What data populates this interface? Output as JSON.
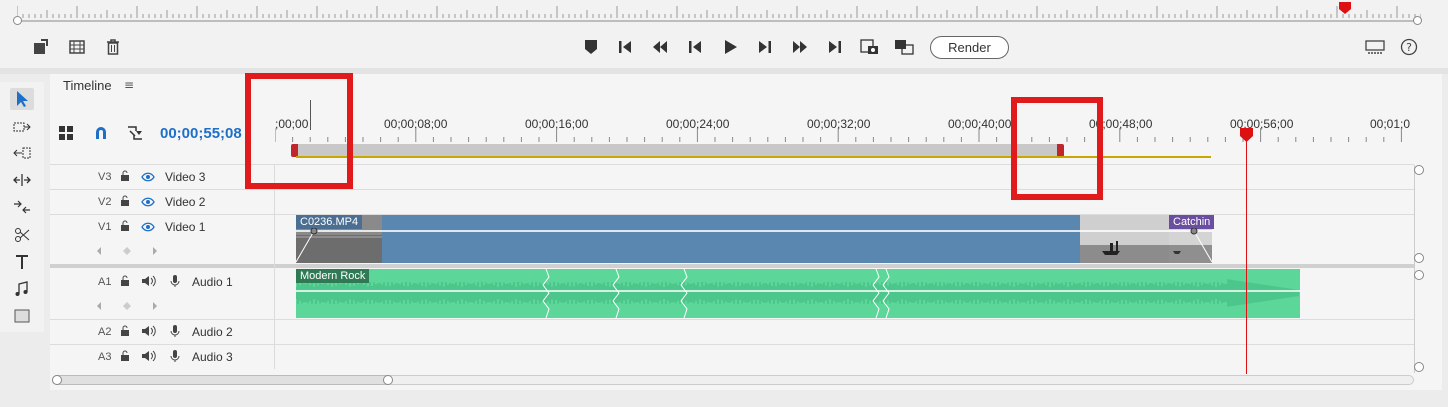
{
  "monitor": {
    "render_label": "Render"
  },
  "timeline": {
    "panel_title": "Timeline",
    "menu_icon": "hamburger-icon",
    "timecode": "00;00;55;08",
    "ruler_labels": [
      ";00;00",
      "00;00;08;00",
      "00;00;16;00",
      "00;00;24;00",
      "00;00;32;00",
      "00;00;40;00",
      "00;00;48;00",
      "00;00;56;00",
      "00;01;0"
    ]
  },
  "tracks": {
    "v3": {
      "id": "V3",
      "name": "Video 3"
    },
    "v2": {
      "id": "V2",
      "name": "Video 2"
    },
    "v1": {
      "id": "V1",
      "name": "Video 1"
    },
    "a1": {
      "id": "A1",
      "name": "Audio 1"
    },
    "a2": {
      "id": "A2",
      "name": "Audio 2"
    },
    "a3": {
      "id": "A3",
      "name": "Audio 3"
    }
  },
  "clips": {
    "video_main": "C0236.MP4",
    "video_end": "Catchin",
    "audio_main": "Modern Rock"
  },
  "colors": {
    "accent": "#1e6fc8",
    "video_clip": "#5a87b0",
    "audio_clip": "#5dd69a",
    "highlight": "#e11b1b",
    "playhead": "#d11111"
  }
}
